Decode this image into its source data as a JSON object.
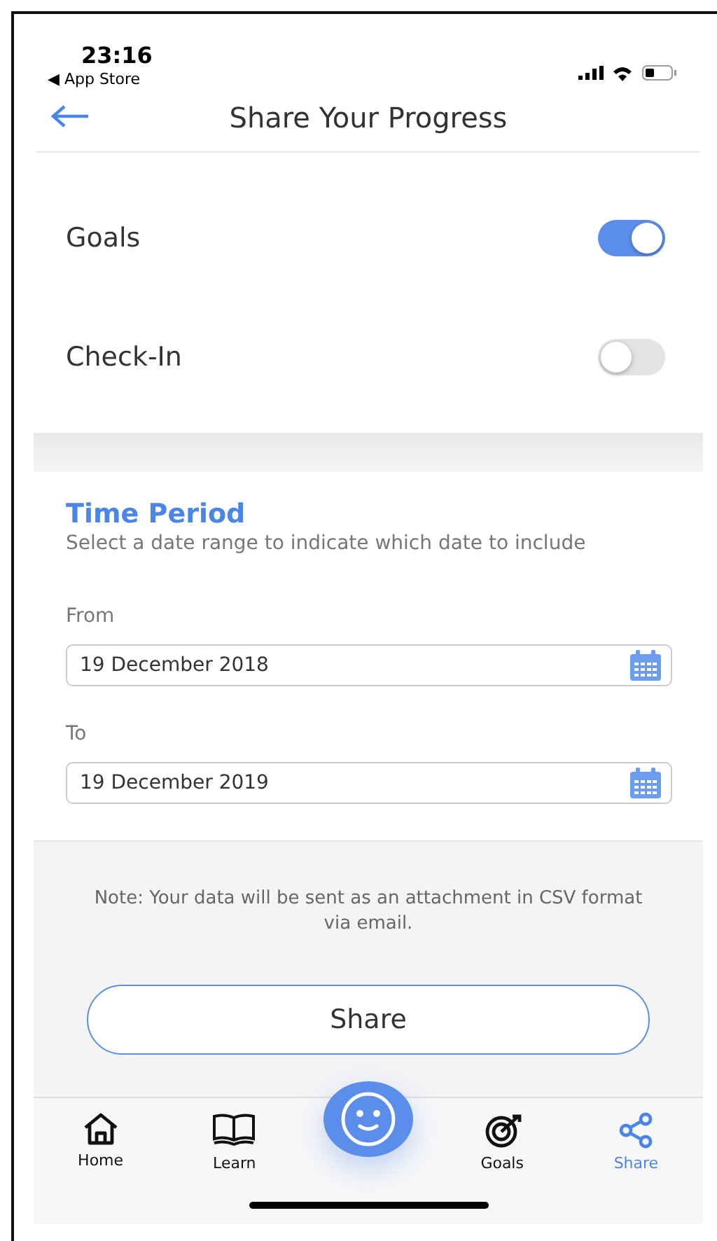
{
  "status_bar": {
    "time": "23:16",
    "back_app": "◀ App Store"
  },
  "header": {
    "title": "Share Your Progress"
  },
  "toggles": [
    {
      "label": "Goals",
      "on": true
    },
    {
      "label": "Check-In",
      "on": false
    }
  ],
  "time_period": {
    "title": "Time Period",
    "subtitle": "Select a date range to indicate which date to include",
    "fields": [
      {
        "label": "From",
        "value": "19 December 2018"
      },
      {
        "label": "To",
        "value": "19 December 2019"
      }
    ]
  },
  "note": "Note: Your data will be sent as an attachment in CSV format via email.",
  "share_button": "Share",
  "tabs": [
    {
      "label": "Home",
      "selected": false
    },
    {
      "label": "Learn",
      "selected": false
    },
    {
      "label": "Goals",
      "selected": false
    },
    {
      "label": "Share",
      "selected": true
    }
  ]
}
